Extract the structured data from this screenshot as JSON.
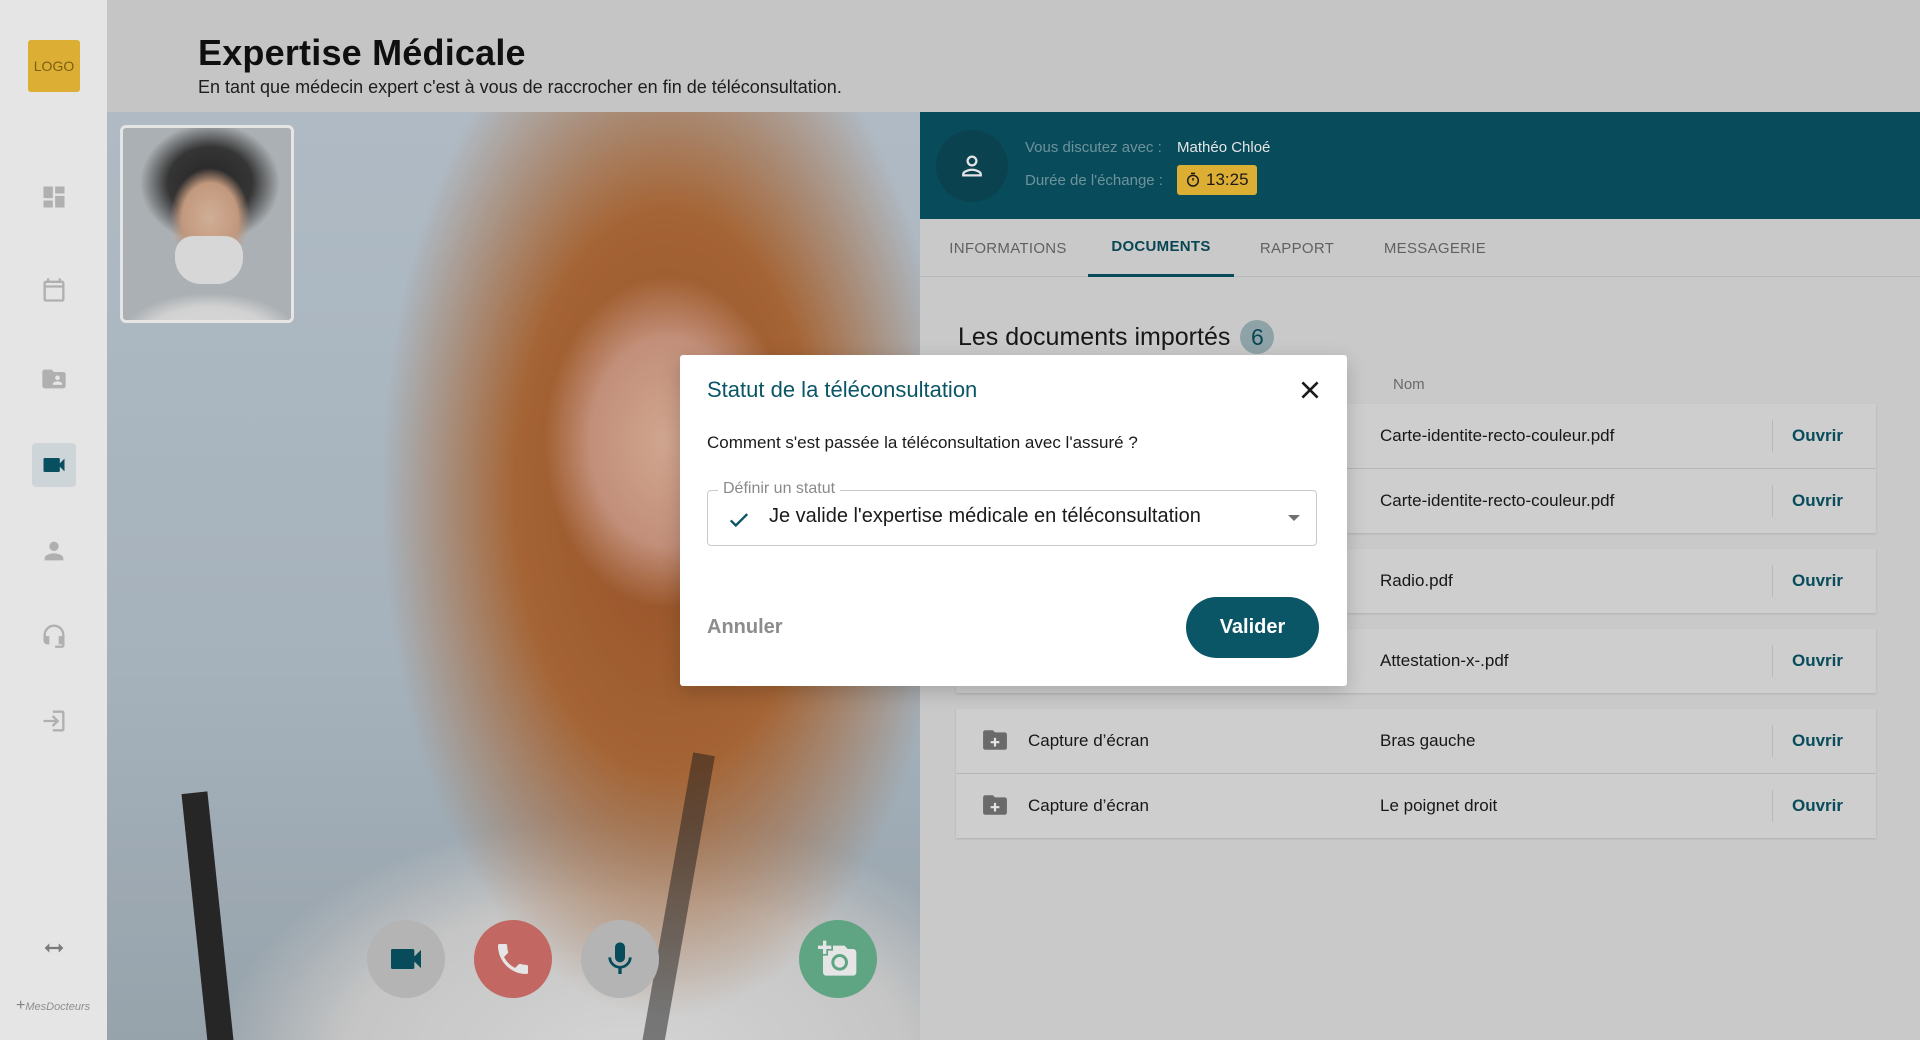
{
  "logo": {
    "label": "LOGO",
    "color": "#f5c23a"
  },
  "brand": {
    "label": "MesDocteurs"
  },
  "sidebar": {
    "items": [
      {
        "name": "dashboard",
        "icon": "dashboard-icon"
      },
      {
        "name": "calendar",
        "icon": "calendar-icon"
      },
      {
        "name": "patient-folder",
        "icon": "folder-user-icon"
      },
      {
        "name": "video-consultation",
        "icon": "video-icon",
        "active": true
      },
      {
        "name": "profile",
        "icon": "user-icon"
      },
      {
        "name": "support",
        "icon": "headset-icon"
      },
      {
        "name": "logout",
        "icon": "logout-icon"
      }
    ],
    "collapse_icon": "collapse-arrows-icon"
  },
  "header": {
    "title": "Expertise Médicale",
    "subtitle": "En tant que médecin expert c'est à vous de raccrocher en fin de téléconsultation."
  },
  "video": {
    "controls": [
      {
        "name": "camera",
        "icon": "video-camera-icon"
      },
      {
        "name": "hang-up",
        "icon": "phone-icon",
        "color": "#d8736c"
      },
      {
        "name": "microphone",
        "icon": "microphone-icon"
      },
      {
        "name": "screenshot",
        "icon": "add-photo-icon",
        "color": "#6ab892"
      }
    ]
  },
  "caller": {
    "with_label": "Vous discutez avec :",
    "with_value": "Mathéo Chloé",
    "duration_label": "Durée de l'échange :",
    "duration_value": "13:25",
    "color": "#0a5566"
  },
  "tabs": [
    {
      "label": "INFORMATIONS",
      "active": false
    },
    {
      "label": "DOCUMENTS",
      "active": true
    },
    {
      "label": "RAPPORT",
      "active": false
    },
    {
      "label": "MESSAGERIE",
      "active": false
    }
  ],
  "documents": {
    "title": "Les documents importés",
    "count": "6",
    "column_name": "Nom",
    "open_label": "Ouvrir",
    "rows": [
      {
        "type": "",
        "name": "Carte-identite-recto-couleur.pdf"
      },
      {
        "type": "",
        "name": "Carte-identite-recto-couleur.pdf"
      },
      {
        "type": "",
        "name": "Radio.pdf"
      },
      {
        "type": "",
        "name": "Attestation-x-.pdf"
      },
      {
        "type": "Capture d’écran",
        "name": "Bras gauche"
      },
      {
        "type": "Capture d’écran",
        "name": "Le poignet droit"
      }
    ]
  },
  "modal": {
    "title": "Statut de la téléconsultation",
    "question": "Comment s'est passée la téléconsultation avec l'assuré ?",
    "field_label": "Définir un statut",
    "field_value": "Je valide l'expertise médicale en téléconsultation",
    "cancel_label": "Annuler",
    "validate_label": "Valider"
  }
}
